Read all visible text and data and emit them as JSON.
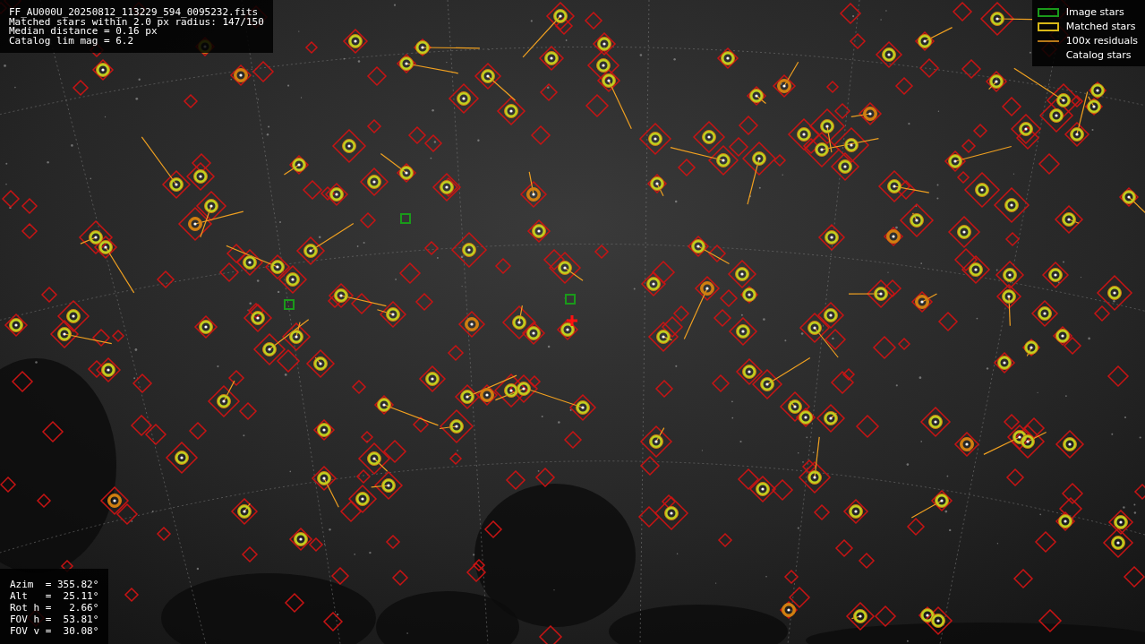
{
  "info_box": {
    "lines": [
      "FF_AU000U_20250812_113229_594_0095232.fits",
      "Matched stars within 2.0 px radius: 147/150",
      "Median distance = 0.16 px",
      "Catalog lim mag = 6.2"
    ]
  },
  "legend": [
    {
      "kind": "image",
      "label": "Image stars"
    },
    {
      "kind": "matched",
      "label": "Matched stars"
    },
    {
      "kind": "residual",
      "label": "100x residuals"
    },
    {
      "kind": "catalog",
      "label": "Catalog stars"
    }
  ],
  "pointing_box": {
    "lines": [
      "Azim  = 355.82°",
      "Alt   =  25.11°",
      "Rot h =   2.66°",
      "FOV h =  53.81°",
      "FOV v =  30.08°"
    ]
  }
}
